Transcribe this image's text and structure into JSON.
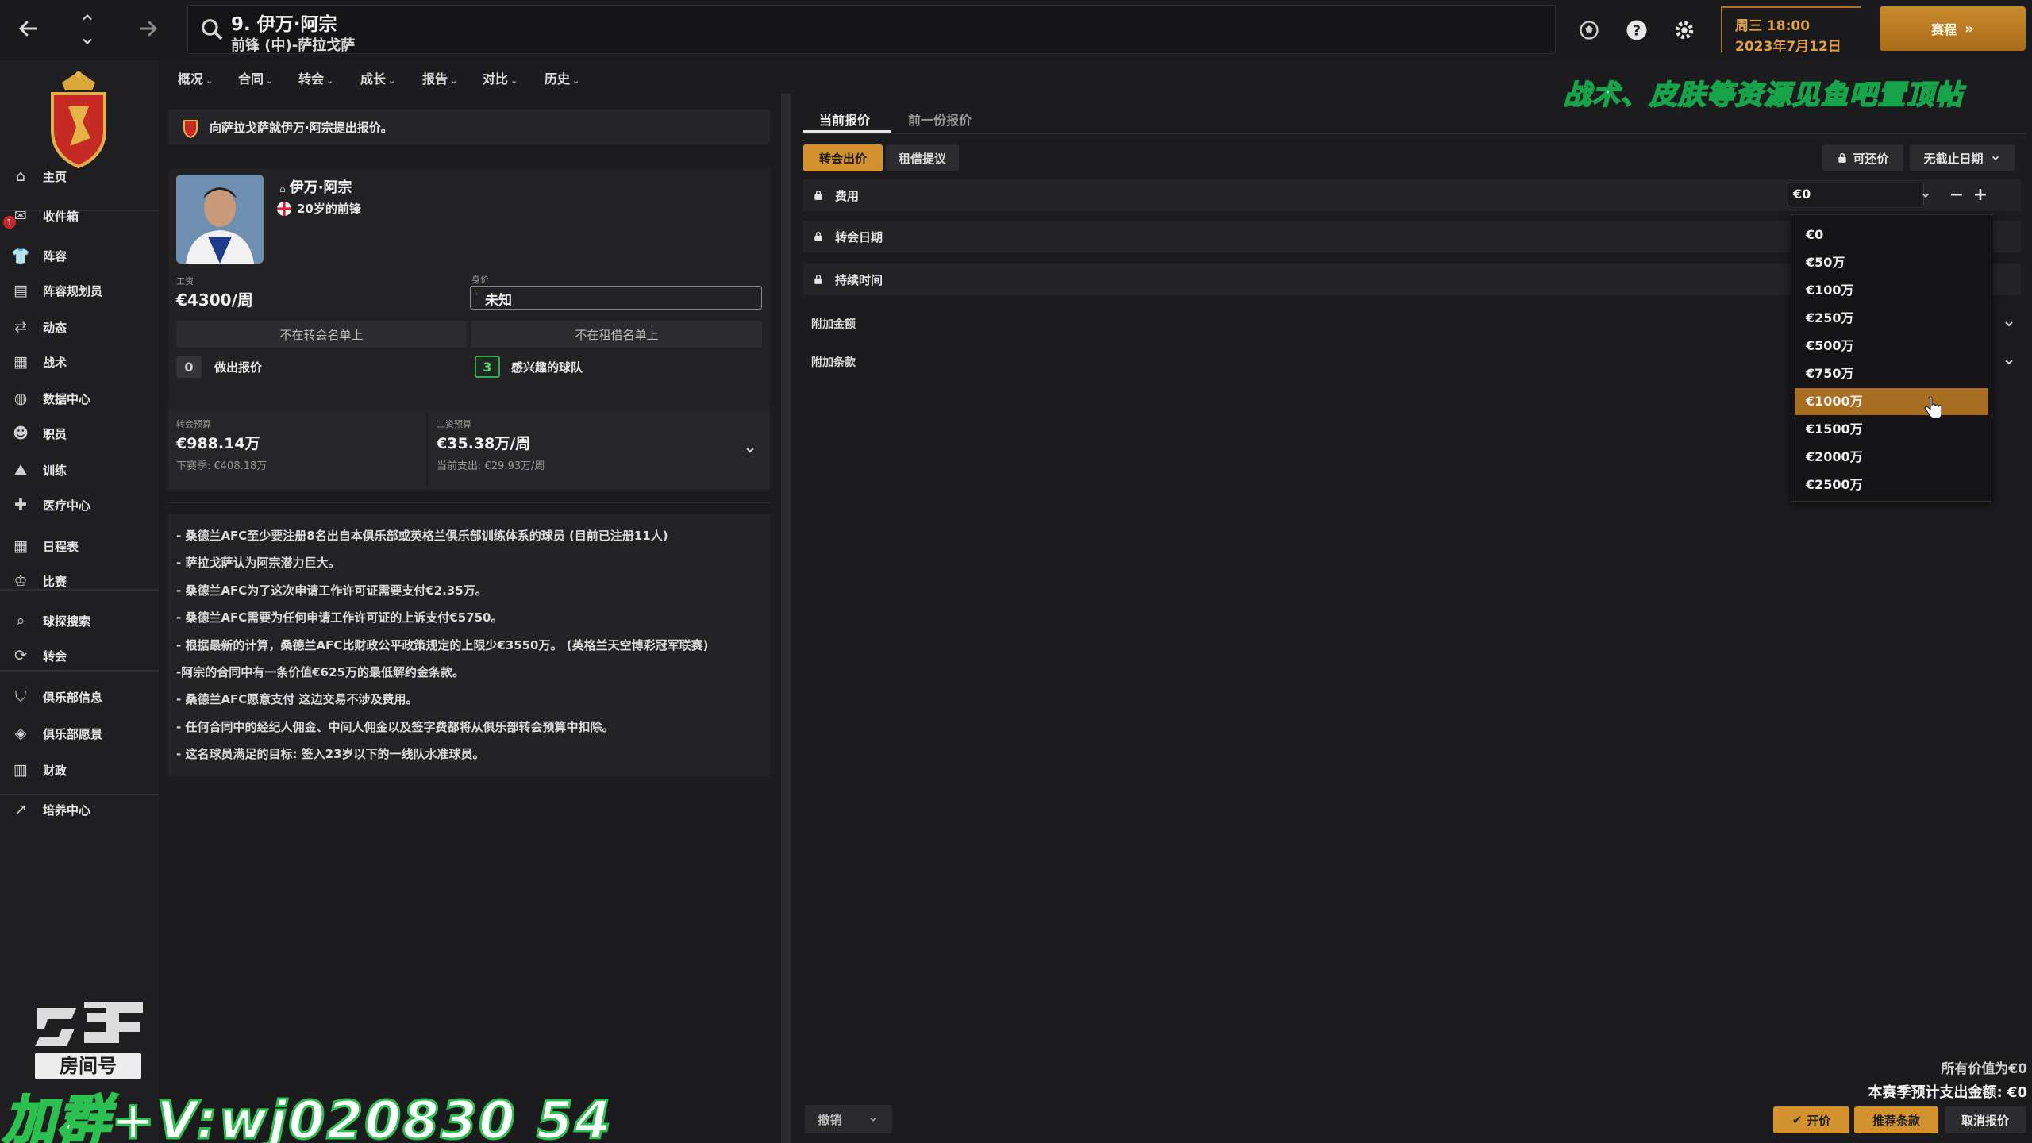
{
  "header": {
    "player_title": "9. 伊万·阿宗",
    "player_sub": "前锋 (中)-萨拉戈萨",
    "date_time": "周三 18:00",
    "date_day": "2023年7月12日",
    "continue_label": "赛程"
  },
  "sidebar": {
    "items": [
      {
        "label": "主页",
        "icon": "home-icon"
      },
      {
        "label": "收件箱",
        "icon": "inbox-icon"
      },
      {
        "label": "阵容",
        "icon": "shirt-icon"
      },
      {
        "label": "阵容规划员",
        "icon": "clipboard-icon"
      },
      {
        "label": "动态",
        "icon": "dynamics-icon"
      },
      {
        "label": "战术",
        "icon": "tactics-icon"
      },
      {
        "label": "数据中心",
        "icon": "data-icon"
      },
      {
        "label": "职员",
        "icon": "staff-icon"
      },
      {
        "label": "训练",
        "icon": "training-icon"
      },
      {
        "label": "医疗中心",
        "icon": "medical-icon"
      },
      {
        "label": "日程表",
        "icon": "calendar-icon"
      },
      {
        "label": "比赛",
        "icon": "trophy-icon"
      },
      {
        "label": "球探搜索",
        "icon": "scout-icon"
      },
      {
        "label": "转会",
        "icon": "transfer-icon"
      },
      {
        "label": "俱乐部信息",
        "icon": "shield-icon"
      },
      {
        "label": "俱乐部愿景",
        "icon": "vision-icon"
      },
      {
        "label": "财政",
        "icon": "finance-icon"
      },
      {
        "label": "培养中心",
        "icon": "development-icon"
      }
    ],
    "inbox_badge": "1",
    "watermark_room": "房间号"
  },
  "menu": [
    "概况",
    "合同",
    "转会",
    "成长",
    "报告",
    "对比",
    "历史"
  ],
  "offer_header": "向萨拉戈萨就伊万·阿宗提出报价。",
  "player": {
    "name": "伊万·阿宗",
    "age_pos": "20岁的前锋",
    "wage_label": "工资",
    "wage": "€4300/周",
    "value_label": "身价",
    "value": "未知",
    "not_transfer_list": "不在转会名单上",
    "not_loan_list": "不在租借名单上",
    "offers_count": "0",
    "offers_label": "做出报价",
    "interested_count": "3",
    "interested_label": "感兴趣的球队"
  },
  "budget": {
    "transfer_label": "转会预算",
    "transfer_value": "€988.14万",
    "transfer_next": "下赛季: €408.18万",
    "wage_label": "工资预算",
    "wage_value": "€35.38万/周",
    "wage_current": "当前支出: €29.93万/周"
  },
  "notes": [
    "- 桑德兰AFC至少要注册8名出自本俱乐部或英格兰俱乐部训练体系的球员 (目前已注册11人)",
    "- 萨拉戈萨认为阿宗潜力巨大。",
    "- 桑德兰AFC为了这次申请工作许可证需要支付€2.35万。",
    "- 桑德兰AFC需要为任何申请工作许可证的上诉支付€5750。",
    "- 根据最新的计算，桑德兰AFC比财政公平政策规定的上限少€3550万。 (英格兰天空博彩冠军联赛)",
    "-阿宗的合同中有一条价值€625万的最低解约金条款。",
    "- 桑德兰AFC愿意支付 这边交易不涉及费用。",
    "- 任何合同中的经纪人佣金、中间人佣金以及签字费都将从俱乐部转会预算中扣除。",
    "- 这名球员满足的目标: 签入23岁以下的一线队水准球员。"
  ],
  "tabs": {
    "current": "当前报价",
    "previous": "前一份报价"
  },
  "offer_type": {
    "transfer": "转会出价",
    "loan": "租借提议"
  },
  "right_controls": {
    "negotiable": "可还价",
    "deadline": "无截止日期"
  },
  "rows": {
    "fee": "费用",
    "transfer_date": "转会日期",
    "duration": "持续时间",
    "add_ons": "附加金额",
    "clauses": "附加条款"
  },
  "fee_select": {
    "value": "€0",
    "options": [
      "€0",
      "€50万",
      "€100万",
      "€250万",
      "€500万",
      "€750万",
      "€1000万",
      "€1500万",
      "€2000万",
      "€2500万"
    ],
    "selected_index": 6
  },
  "bottom": {
    "undo": "撤销",
    "summary_all": "所有价值为€0",
    "summary_season": "本赛季预计支出金额: €0",
    "make_offer": "开价",
    "suggest": "推荐条款",
    "cancel": "取消报价"
  },
  "watermarks": {
    "banner": "战术、皮肤等资源见鱼吧置顶帖",
    "contact": "加群+V:wj020830 54"
  },
  "colors": {
    "accent": "#d4922f",
    "accent_dark": "#a86f22",
    "green": "#3aa655"
  }
}
